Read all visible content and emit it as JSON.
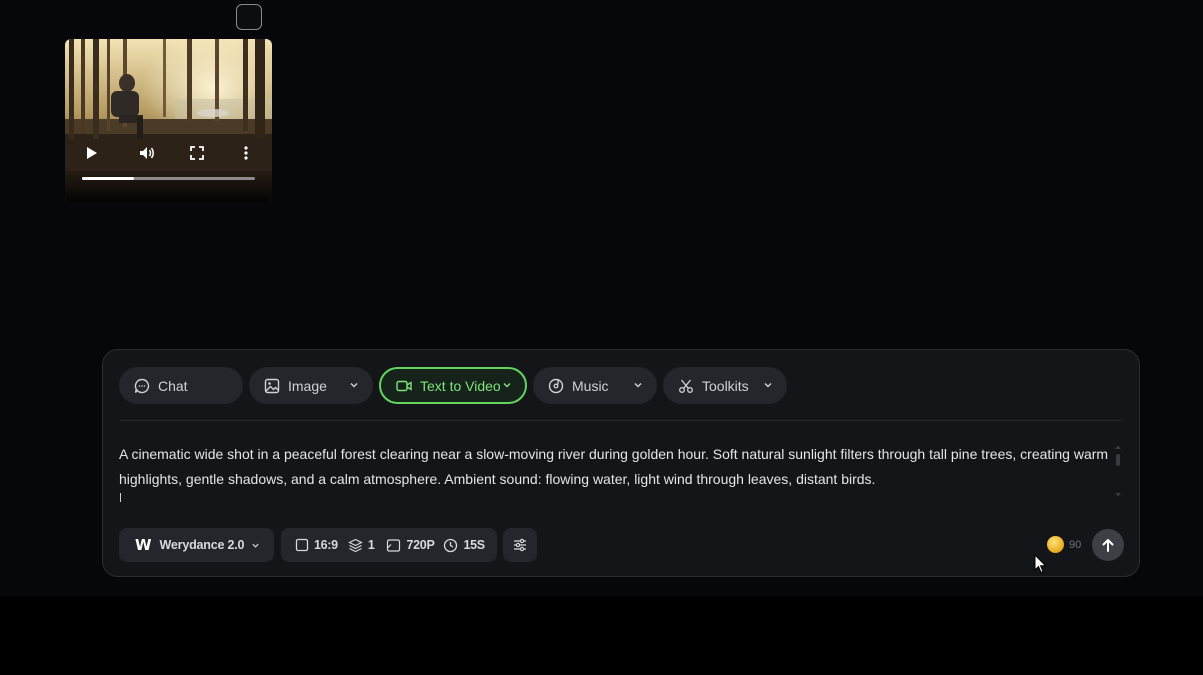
{
  "video": {
    "progress_fraction": 0.3
  },
  "tabs": [
    {
      "label": "Chat",
      "icon": "chat-bubble-icon",
      "has_dropdown": false
    },
    {
      "label": "Image",
      "icon": "image-icon",
      "has_dropdown": true
    },
    {
      "label": "Text to Video",
      "icon": "video-camera-icon",
      "has_dropdown": true,
      "active": true
    },
    {
      "label": "Music",
      "icon": "music-disc-icon",
      "has_dropdown": true
    },
    {
      "label": "Toolkits",
      "icon": "scissors-icon",
      "has_dropdown": true
    }
  ],
  "prompt": {
    "text": "A cinematic wide shot in a peaceful forest clearing near a slow-moving river during golden hour. Soft natural sunlight filters through tall pine trees, creating warm highlights, gentle shadows, and a calm atmosphere. Ambient sound: flowing water, light wind through leaves, distant birds."
  },
  "model": {
    "logo": "W",
    "label": "Werydance 2.0"
  },
  "settings": {
    "aspect_ratio": "16:9",
    "count": "1",
    "resolution": "720P",
    "duration": "15S"
  },
  "credits": {
    "value": "90"
  },
  "colors": {
    "active_tab_border": "#62d45f",
    "active_tab_text": "#7ee37b",
    "panel_bg": "#141519",
    "pill_bg": "#24262b",
    "coin": "#e8a91a"
  }
}
